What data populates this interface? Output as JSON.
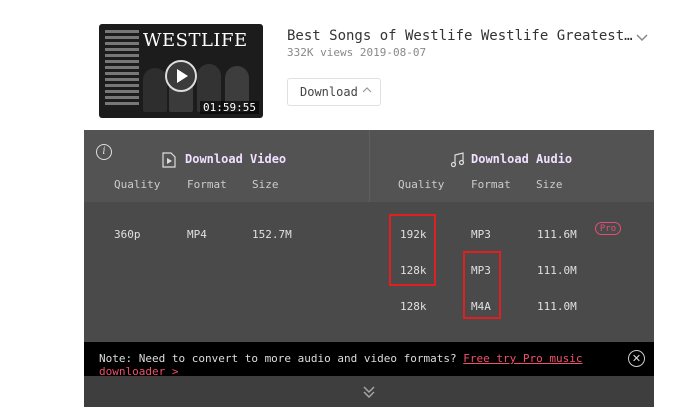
{
  "video": {
    "thumbnail_brand": "WESTLIFE",
    "duration": "01:59:55",
    "title": "Best Songs of Westlife Westlife Greatest…",
    "meta": "332K views 2019-08-07",
    "download_label": "Download"
  },
  "panel": {
    "video_section": {
      "title": "Download Video",
      "columns": [
        "Quality",
        "Format",
        "Size"
      ],
      "rows": [
        {
          "quality": "360p",
          "format": "MP4",
          "size": "152.7M"
        }
      ]
    },
    "audio_section": {
      "title": "Download Audio",
      "columns": [
        "Quality",
        "Format",
        "Size"
      ],
      "rows": [
        {
          "quality": "192k",
          "format": "MP3",
          "size": "111.6M",
          "badge": "Pro"
        },
        {
          "quality": "128k",
          "format": "MP3",
          "size": "111.0M"
        },
        {
          "quality": "128k",
          "format": "M4A",
          "size": "111.0M"
        }
      ]
    },
    "note": {
      "prefix": "Note: Need to convert to more audio and video formats?",
      "link": "Free try Pro music downloader >",
      "close": "✕"
    }
  },
  "colors": {
    "panel_bg": "#4a4a4a",
    "panel_header": "#535353",
    "note_bg": "#000000",
    "link": "#f0506e",
    "highlight": "#e02020",
    "section_title": "#f0e0ff"
  }
}
